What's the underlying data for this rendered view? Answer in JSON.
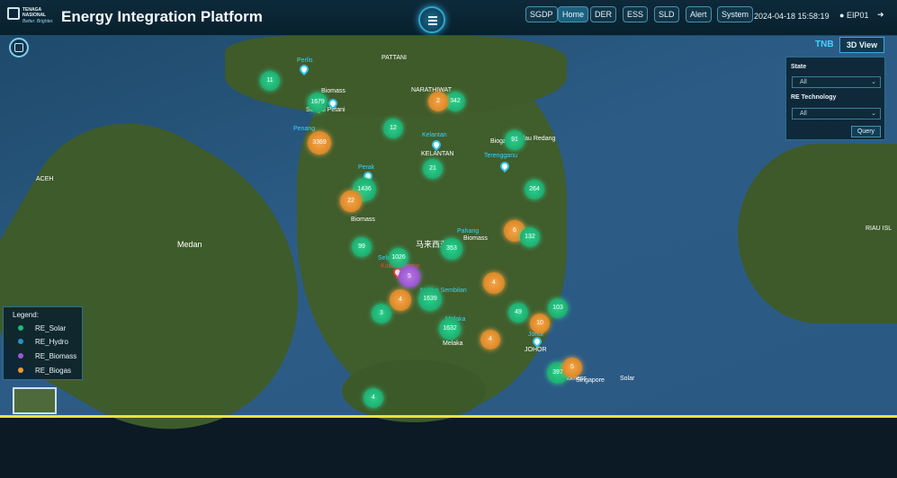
{
  "header": {
    "logo_lines": [
      "TENAGA",
      "NASIONAL",
      "Better. Brighter."
    ],
    "title": "Energy Integration Platform",
    "nav": [
      "SGDP",
      "Home",
      "DER",
      "ESS",
      "SLD",
      "Alert",
      "System"
    ],
    "active_nav": "Home",
    "datetime": "2024-04-18 15:58:19",
    "user": "EIP01",
    "user_icon": "user-icon",
    "logout_icon": "logout-icon"
  },
  "map_controls": {
    "tnb_label": "TNB",
    "view3d_label": "3D View"
  },
  "filter": {
    "state_label": "State",
    "state_value": "All",
    "tech_label": "RE Technology",
    "tech_value": "All",
    "query_label": "Query"
  },
  "legend": {
    "title": "Legend:",
    "items": [
      {
        "label": "RE_Solar",
        "color": "#1fb97a"
      },
      {
        "label": "RE_Hydro",
        "color": "#2a8fc4"
      },
      {
        "label": "RE_Biomass",
        "color": "#9b59d6"
      },
      {
        "label": "RE_Biogas",
        "color": "#f09a2a"
      }
    ]
  },
  "map_labels": [
    "PATTANI",
    "NARATHIWAT",
    "KELANTAN",
    "ACEH",
    "Medan",
    "Melaka",
    "JOHOR",
    "Singapore",
    "RIAU ISL",
    "马来西亚",
    "Sungai Petani",
    "Pulau Redang"
  ],
  "clusters": [
    {
      "label": "11",
      "type": "solar"
    },
    {
      "label": "1679",
      "type": "solar"
    },
    {
      "label": "3369",
      "type": "biogas"
    },
    {
      "label": "12",
      "type": "solar"
    },
    {
      "label": "342",
      "type": "solar"
    },
    {
      "label": "2",
      "type": "biogas"
    },
    {
      "label": "21",
      "type": "solar"
    },
    {
      "label": "91",
      "type": "solar"
    },
    {
      "label": "1436",
      "type": "solar"
    },
    {
      "label": "264",
      "type": "solar"
    },
    {
      "label": "22",
      "type": "biogas"
    },
    {
      "label": "99",
      "type": "solar"
    },
    {
      "label": "1026",
      "type": "solar"
    },
    {
      "label": "6",
      "type": "biogas"
    },
    {
      "label": "132",
      "type": "solar"
    },
    {
      "label": "353",
      "type": "solar"
    },
    {
      "label": "5",
      "type": "biomass"
    },
    {
      "label": "4",
      "type": "biogas"
    },
    {
      "label": "1639",
      "type": "solar"
    },
    {
      "label": "4",
      "type": "biogas"
    },
    {
      "label": "49",
      "type": "solar"
    },
    {
      "label": "103",
      "type": "solar"
    },
    {
      "label": "3",
      "type": "solar"
    },
    {
      "label": "1632",
      "type": "solar"
    },
    {
      "label": "10",
      "type": "biogas"
    },
    {
      "label": "4",
      "type": "biogas"
    },
    {
      "label": "397",
      "type": "solar"
    },
    {
      "label": "5",
      "type": "biogas"
    },
    {
      "label": "4",
      "type": "solar"
    }
  ],
  "site_labels": [
    "Perlis",
    "Biomass",
    "Penang",
    "Kelantan",
    "Biogas",
    "Terengganu",
    "Perak",
    "Biomass",
    "Pahang",
    "Biomass",
    "Selangor",
    "Kuala Lumpur",
    "Negeri Sembilan",
    "Melaka",
    "Johor",
    "Biomass",
    "Solar"
  ]
}
